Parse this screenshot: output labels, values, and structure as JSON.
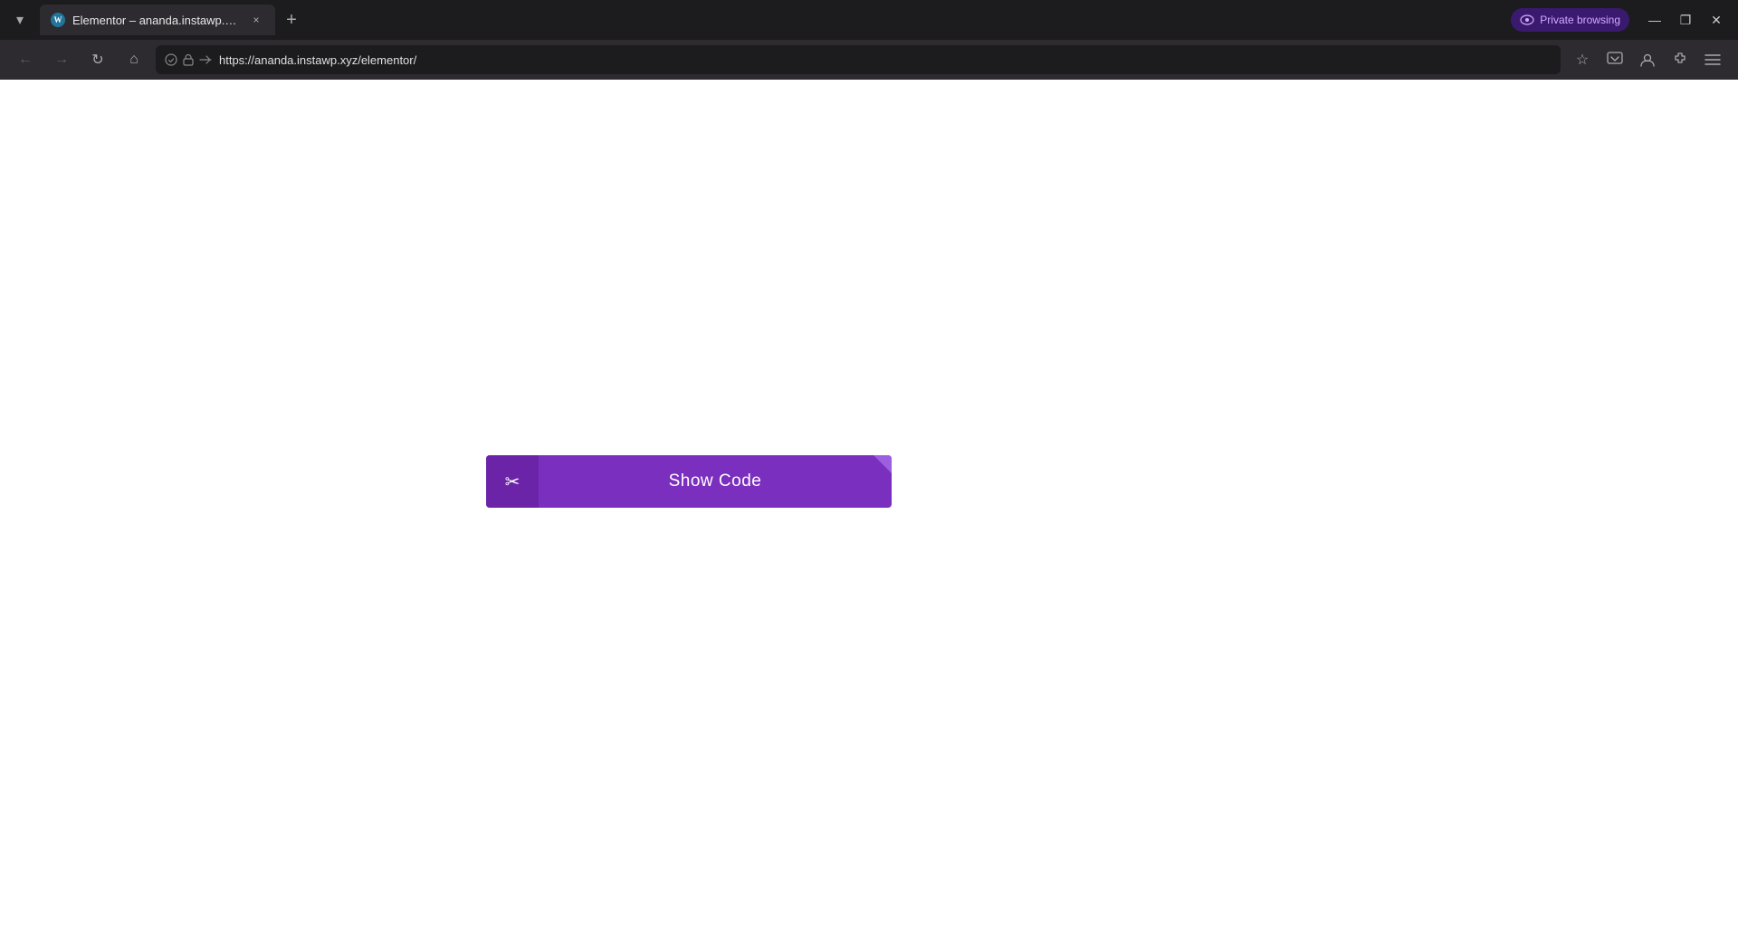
{
  "browser": {
    "title_bar": {
      "tab": {
        "favicon_letter": "W",
        "title": "Elementor – ananda.instawp.xyz",
        "close_label": "×"
      },
      "new_tab_label": "+",
      "tab_list_label": "▾",
      "private_browsing": {
        "label": "Private browsing",
        "icon": "👁"
      },
      "window_controls": {
        "minimize": "—",
        "restore": "❐",
        "close": "✕"
      }
    },
    "nav_bar": {
      "back_label": "←",
      "forward_label": "→",
      "reload_label": "↻",
      "home_label": "⌂",
      "url": "https://ananda.instawp.xyz/elementor/",
      "security_icon": "🔒",
      "permissions_icon": "⇄",
      "bookmark_label": "☆",
      "account_icon": "👤",
      "extensions_icon": "🧩",
      "menu_icon": "≡"
    },
    "page": {
      "background": "#ffffff",
      "show_code_button": {
        "label": "Show Code",
        "icon": "✂",
        "bg_color": "#7b2fbe",
        "icon_bg_color": "#6b24a8"
      }
    }
  }
}
